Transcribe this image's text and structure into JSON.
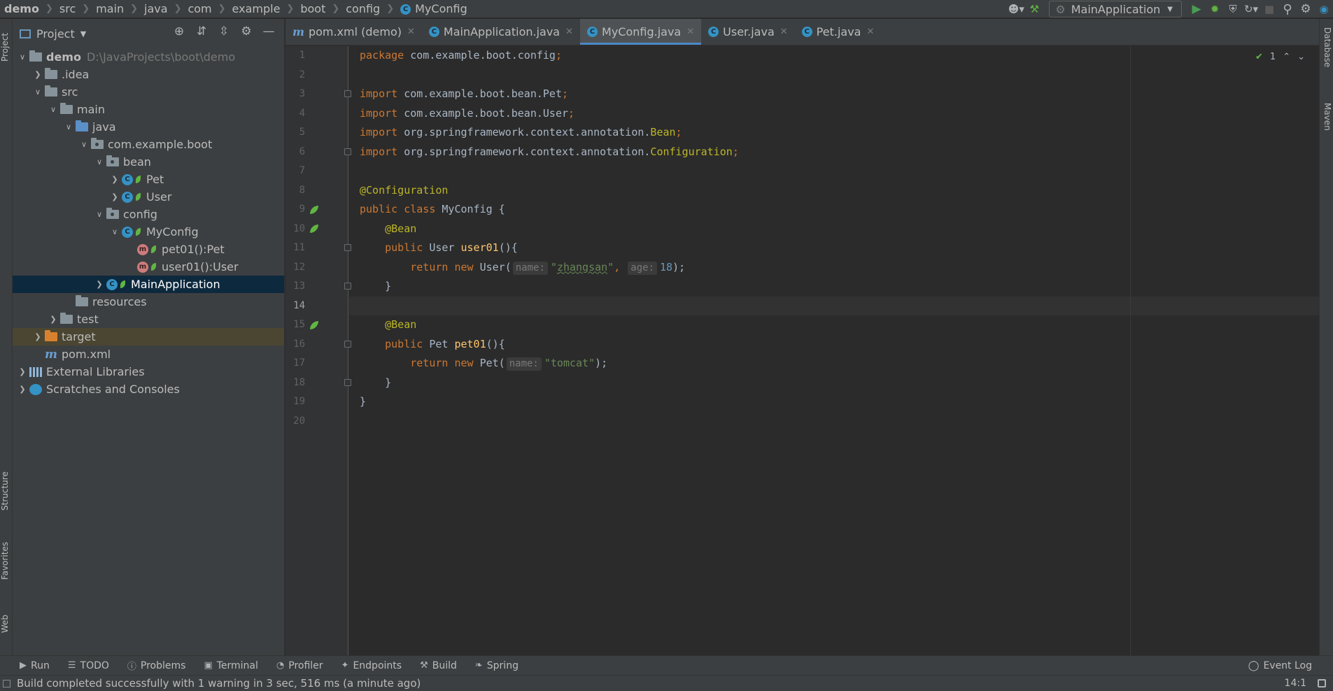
{
  "breadcrumbs": [
    "demo",
    "src",
    "main",
    "java",
    "com",
    "example",
    "boot",
    "config",
    "MyConfig"
  ],
  "run_config": "MainApplication",
  "project_panel": {
    "title": "Project",
    "tree": [
      {
        "label": "demo",
        "extra": "D:\\JavaProjects\\boot\\demo",
        "level": 0,
        "toggle": "open",
        "icon": "module-folder"
      },
      {
        "label": ".idea",
        "level": 1,
        "toggle": "closed",
        "icon": "folder"
      },
      {
        "label": "src",
        "level": 1,
        "toggle": "open",
        "icon": "folder"
      },
      {
        "label": "main",
        "level": 2,
        "toggle": "open",
        "icon": "folder"
      },
      {
        "label": "java",
        "level": 3,
        "toggle": "open",
        "icon": "source-folder"
      },
      {
        "label": "com.example.boot",
        "level": 4,
        "toggle": "open",
        "icon": "package"
      },
      {
        "label": "bean",
        "level": 5,
        "toggle": "open",
        "icon": "package"
      },
      {
        "label": "Pet",
        "level": 6,
        "toggle": "closed",
        "icon": "class"
      },
      {
        "label": "User",
        "level": 6,
        "toggle": "closed",
        "icon": "class"
      },
      {
        "label": "config",
        "level": 5,
        "toggle": "open",
        "icon": "package"
      },
      {
        "label": "MyConfig",
        "level": 6,
        "toggle": "open",
        "icon": "class"
      },
      {
        "label": "pet01():Pet",
        "level": 7,
        "toggle": "none",
        "icon": "method"
      },
      {
        "label": "user01():User",
        "level": 7,
        "toggle": "none",
        "icon": "method"
      },
      {
        "label": "MainApplication",
        "level": 5,
        "toggle": "closed",
        "icon": "spring-class",
        "selected": true
      },
      {
        "label": "resources",
        "level": 3,
        "toggle": "none",
        "icon": "resources-folder"
      },
      {
        "label": "test",
        "level": 2,
        "toggle": "closed",
        "icon": "folder"
      },
      {
        "label": "target",
        "level": 1,
        "toggle": "closed",
        "icon": "excluded-folder",
        "excluded": true
      },
      {
        "label": "pom.xml",
        "level": 1,
        "toggle": "none",
        "icon": "maven-file"
      },
      {
        "label": "External Libraries",
        "level": 0,
        "toggle": "closed",
        "icon": "libraries"
      },
      {
        "label": "Scratches and Consoles",
        "level": 0,
        "toggle": "closed",
        "icon": "scratches"
      }
    ]
  },
  "tabs": [
    {
      "label": "pom.xml (demo)",
      "icon": "maven-file",
      "active": false
    },
    {
      "label": "MainApplication.java",
      "icon": "spring-class",
      "active": false
    },
    {
      "label": "MyConfig.java",
      "icon": "class",
      "active": true
    },
    {
      "label": "User.java",
      "icon": "class",
      "active": false
    },
    {
      "label": "Pet.java",
      "icon": "class",
      "active": false
    }
  ],
  "editor": {
    "current_line": 14,
    "inspection_count": "1",
    "lines": [
      [
        {
          "t": "package",
          "c": "kw"
        },
        {
          "t": " com.example.boot.config"
        },
        {
          "t": ";",
          "c": "kw"
        }
      ],
      [],
      [
        {
          "t": "import",
          "c": "kw"
        },
        {
          "t": " com.example.boot.bean.Pet"
        },
        {
          "t": ";",
          "c": "kw"
        }
      ],
      [
        {
          "t": "import",
          "c": "kw"
        },
        {
          "t": " com.example.boot.bean.User"
        },
        {
          "t": ";",
          "c": "kw"
        }
      ],
      [
        {
          "t": "import",
          "c": "kw"
        },
        {
          "t": " org.springframework.context.annotation."
        },
        {
          "t": "Bean",
          "c": "ann"
        },
        {
          "t": ";",
          "c": "kw"
        }
      ],
      [
        {
          "t": "import",
          "c": "kw"
        },
        {
          "t": " org.springframework.context.annotation."
        },
        {
          "t": "Configuration",
          "c": "ann"
        },
        {
          "t": ";",
          "c": "kw"
        }
      ],
      [],
      [
        {
          "t": "@Configuration",
          "c": "ann"
        }
      ],
      [
        {
          "t": "public class",
          "c": "kw"
        },
        {
          "t": " MyConfig {"
        }
      ],
      [
        {
          "t": "    "
        },
        {
          "t": "@Bean",
          "c": "ann"
        }
      ],
      [
        {
          "t": "    "
        },
        {
          "t": "public",
          "c": "kw"
        },
        {
          "t": " User "
        },
        {
          "t": "user01",
          "c": "fn"
        },
        {
          "t": "(){"
        }
      ],
      [
        {
          "t": "        "
        },
        {
          "t": "return new",
          "c": "kw"
        },
        {
          "t": " User("
        },
        {
          "t": "name:",
          "c": "hint"
        },
        {
          "t": "\"",
          "c": "str"
        },
        {
          "t": "zhangsan",
          "c": "str squig"
        },
        {
          "t": "\"",
          "c": "str"
        },
        {
          "t": ",",
          "c": "kw"
        },
        {
          "t": " "
        },
        {
          "t": "age:",
          "c": "hint"
        },
        {
          "t": "18",
          "c": "num"
        },
        {
          "t": ");"
        }
      ],
      [
        {
          "t": "    }"
        }
      ],
      [],
      [
        {
          "t": "    "
        },
        {
          "t": "@Bean",
          "c": "ann"
        }
      ],
      [
        {
          "t": "    "
        },
        {
          "t": "public",
          "c": "kw"
        },
        {
          "t": " Pet "
        },
        {
          "t": "pet01",
          "c": "fn"
        },
        {
          "t": "(){"
        }
      ],
      [
        {
          "t": "        "
        },
        {
          "t": "return new",
          "c": "kw"
        },
        {
          "t": " Pet("
        },
        {
          "t": "name:",
          "c": "hint"
        },
        {
          "t": "\"tomcat\"",
          "c": "str"
        },
        {
          "t": ");"
        }
      ],
      [
        {
          "t": "    }"
        }
      ],
      [
        {
          "t": "}"
        }
      ],
      []
    ],
    "gutter_icons": {
      "9": "spring-bean-config-icon",
      "10": "spring-bean-icon",
      "15": "spring-bean-icon"
    },
    "fold_lines": [
      3,
      6,
      11,
      13,
      16,
      18
    ]
  },
  "left_stripe": [
    "Project",
    "Structure",
    "Favorites",
    "Web"
  ],
  "right_stripe": [
    "Database",
    "Maven"
  ],
  "tool_windows": [
    {
      "label": "Run",
      "icon": "run-icon"
    },
    {
      "label": "TODO",
      "icon": "todo-icon"
    },
    {
      "label": "Problems",
      "icon": "problems-icon"
    },
    {
      "label": "Terminal",
      "icon": "terminal-icon"
    },
    {
      "label": "Profiler",
      "icon": "profiler-icon"
    },
    {
      "label": "Endpoints",
      "icon": "endpoints-icon"
    },
    {
      "label": "Build",
      "icon": "build-icon"
    },
    {
      "label": "Spring",
      "icon": "spring-icon"
    }
  ],
  "event_log": "Event Log",
  "status": {
    "message": "Build completed successfully with 1 warning in 3 sec, 516 ms (a minute ago)",
    "caret": "14:1"
  }
}
